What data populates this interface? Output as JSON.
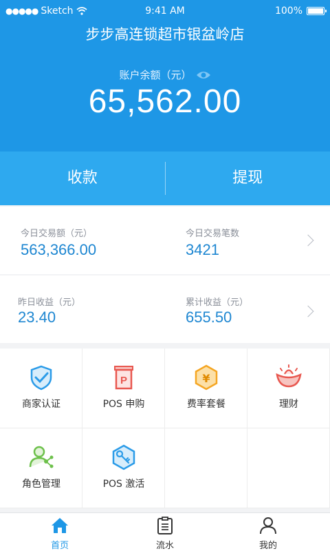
{
  "status_bar": {
    "carrier": "Sketch",
    "time": "9:41 AM",
    "battery": "100%"
  },
  "header": {
    "store_name": "步步高连锁超市银盆岭店",
    "balance_label": "账户余额（元）",
    "balance_value": "65,562.00"
  },
  "actions": {
    "collect": "收款",
    "withdraw": "提现"
  },
  "stats": [
    {
      "left": {
        "label": "今日交易额（元）",
        "value": "563,366.00"
      },
      "right": {
        "label": "今日交易笔数",
        "value": "3421"
      }
    },
    {
      "left": {
        "label": "昨日收益（元）",
        "value": "23.40"
      },
      "right": {
        "label": "累计收益（元）",
        "value": "655.50"
      }
    }
  ],
  "grid": [
    {
      "label": "商家认证",
      "icon": "shield-check-icon",
      "color": "#2a9be8"
    },
    {
      "label": "POS 申购",
      "icon": "pos-apply-icon",
      "color": "#e8574f"
    },
    {
      "label": "费率套餐",
      "icon": "yuan-hexagon-icon",
      "color": "#f5a623"
    },
    {
      "label": "理财",
      "icon": "ingot-icon",
      "color": "#e8574f"
    },
    {
      "label": "角色管理",
      "icon": "user-share-icon",
      "color": "#6cc04a"
    },
    {
      "label": "POS 激活",
      "icon": "key-hexagon-icon",
      "color": "#2a9be8"
    }
  ],
  "tabs": [
    {
      "label": "首页",
      "icon": "home-icon",
      "active": true
    },
    {
      "label": "流水",
      "icon": "clipboard-icon",
      "active": false
    },
    {
      "label": "我的",
      "icon": "person-icon",
      "active": false
    }
  ],
  "colors": {
    "primary": "#1e97e6",
    "action_bar": "#2ea9ef",
    "value_blue": "#1d86d1",
    "inactive_tab": "#333333"
  }
}
